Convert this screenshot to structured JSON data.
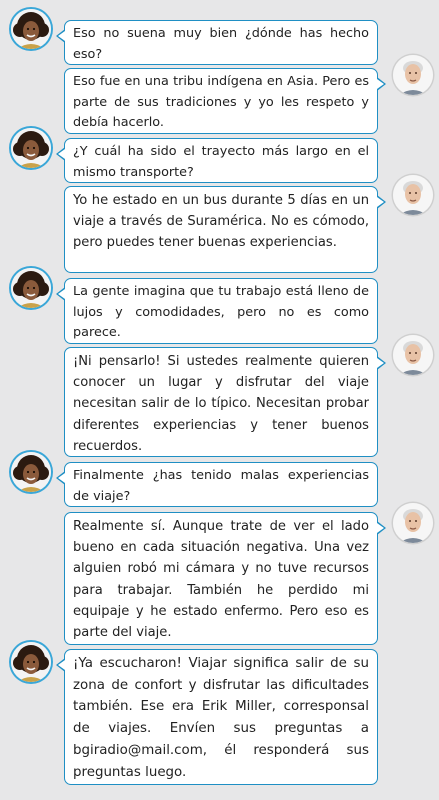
{
  "conversation": {
    "messages": [
      {
        "speaker": "host",
        "text": "Eso no suena muy bien ¿dónde has hecho eso?"
      },
      {
        "speaker": "guest",
        "text": "Eso fue en una tribu indígena en Asia. Pero es parte de sus tradiciones y yo les respeto y debía hacerlo."
      },
      {
        "speaker": "host",
        "text": "¿Y cuál ha sido el trayecto más largo en el mismo transporte?"
      },
      {
        "speaker": "guest",
        "text": "Yo he estado en un bus durante 5 días en un viaje a través de Suramérica. No es cómodo, pero puedes tener buenas experiencias."
      },
      {
        "speaker": "host",
        "text": "La gente imagina que tu trabajo está lleno de lujos  y comodidades, pero no es como parece."
      },
      {
        "speaker": "guest",
        "text": "¡Ni pensarlo! Si ustedes realmente quieren conocer un lugar y disfrutar del viaje necesitan salir de lo típico. Necesitan probar diferentes experiencias y tener buenos recuerdos."
      },
      {
        "speaker": "host",
        "text": "Finalmente ¿has tenido malas experiencias de viaje?"
      },
      {
        "speaker": "guest",
        "text": "Realmente sí. Aunque trate de ver el lado bueno en cada situación negativa. Una vez alguien robó mi cámara y no tuve recursos para trabajar. También he perdido mi equipaje y he estado enfermo. Pero eso es parte del viaje."
      },
      {
        "speaker": "host",
        "text": "¡Ya escucharon! Viajar significa salir de su zona de confort y disfrutar las dificultades también. Ese era Erik Miller, corresponsal de viajes. Envíen sus preguntas a bgiradio@mail.com, él responderá sus preguntas luego."
      }
    ]
  },
  "colors": {
    "background": "#e7e7e8",
    "bubble_border": "#1f8fc4",
    "bubble_fill": "#ffffff",
    "text": "#222222"
  },
  "icons": {
    "host_avatar": "woman-curly-hair-avatar",
    "guest_avatar": "older-man-avatar"
  }
}
